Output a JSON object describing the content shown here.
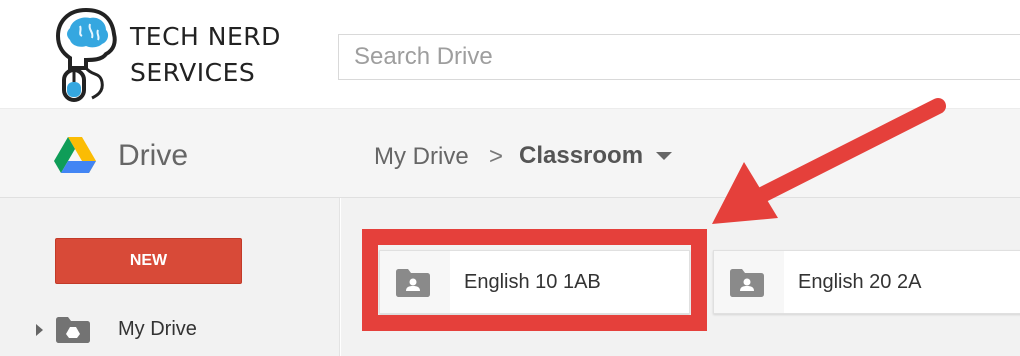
{
  "brand": {
    "line1": "TECH NERD",
    "line2": "SERVICES",
    "logo_icon": "head-mouse-logo-icon",
    "logo_color": "#35a7e0"
  },
  "search": {
    "placeholder": "Search Drive",
    "value": ""
  },
  "drive": {
    "title": "Drive",
    "logo_icon": "google-drive-icon"
  },
  "breadcrumb": {
    "root": "My Drive",
    "separator": ">",
    "current": "Classroom",
    "caret_icon": "dropdown-caret-icon"
  },
  "sidebar": {
    "new_label": "NEW",
    "new_color": "#d84a38",
    "items": [
      {
        "label": "My Drive",
        "icon": "shared-drive-folder-icon",
        "expand_icon": "expand-arrow-icon"
      }
    ]
  },
  "folders": [
    {
      "label": "English 10 1AB",
      "icon": "shared-folder-icon",
      "highlighted": true
    },
    {
      "label": "English 20 2A",
      "icon": "shared-folder-icon",
      "highlighted": false
    }
  ],
  "annotation": {
    "color": "#e5403b",
    "type": "arrow-and-box"
  }
}
